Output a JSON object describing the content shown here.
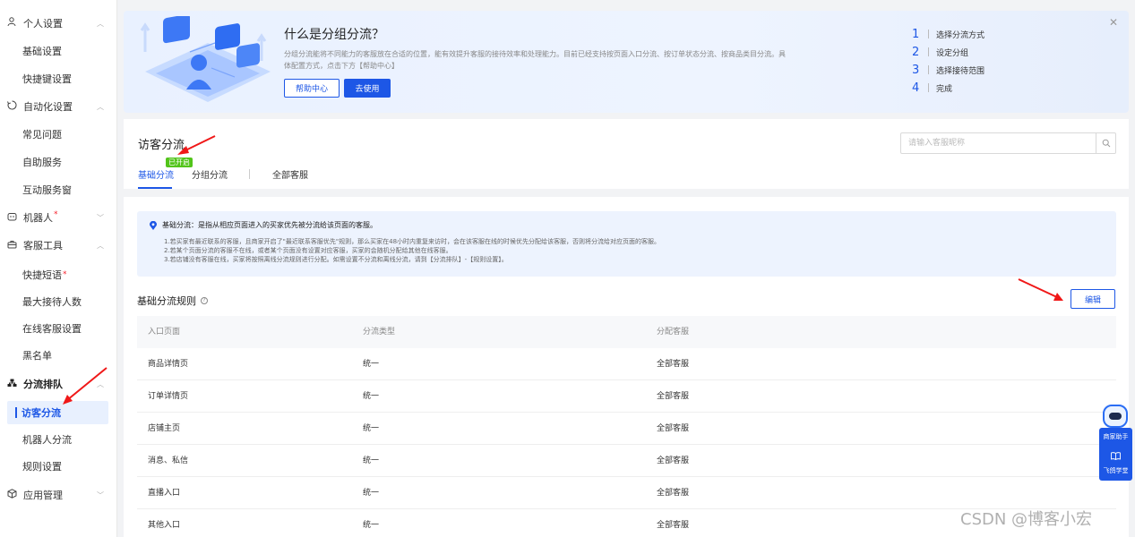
{
  "sidebar": {
    "group_personal": "个人设置",
    "item_basic": "基础设置",
    "item_shortcut": "快捷键设置",
    "group_automation": "自动化设置",
    "item_faq": "常见问题",
    "item_self_service": "自助服务",
    "item_interactive": "互动服务窗",
    "group_robot": "机器人",
    "group_tools": "客服工具",
    "item_quick_phrases": "快捷短语",
    "item_max_reception": "最大接待人数",
    "item_online_settings": "在线客服设置",
    "item_blacklist": "黑名单",
    "group_routing": "分流排队",
    "item_visitor_routing": "访客分流",
    "item_robot_routing": "机器人分流",
    "item_rule_settings": "规则设置",
    "group_app_mgmt": "应用管理",
    "required_marker": "*"
  },
  "banner": {
    "title": "什么是分组分流？",
    "description": "分组分流能将不同能力的客服放在合适的位置，能有效提升客服的接待效率和处理能力。目前已经支持按页面入口分流、按订单状态分流、按商品类目分流。具体配置方式，点击下方【帮助中心】",
    "help_button": "帮助中心",
    "use_button": "去使用",
    "steps": [
      {
        "num": "1",
        "label": "选择分流方式"
      },
      {
        "num": "2",
        "label": "设定分组"
      },
      {
        "num": "3",
        "label": "选择接待范围"
      },
      {
        "num": "4",
        "label": "完成"
      }
    ]
  },
  "header": {
    "title": "访客分流",
    "search_placeholder": "请输入客服昵称",
    "tabs": {
      "basic": "基础分流",
      "group": "分组分流",
      "all": "全部客服",
      "badge": "已开启"
    }
  },
  "info": {
    "headline": "基础分流：是指从相应页面进入的买家优先被分流给该页面的客服。",
    "lines": [
      "1.若买家有最近联系的客服，且商家开启了\"最近联系客服优先\"规则，那么买家在48小时内重复来访时，会在该客服在线的时候优先分配给该客服，否则将分流给对应页面的客服。",
      "2.若某个页面分流的客服不在线，或者某个页面没有设置对应客服，买家的会随机分配给其他在线客服。",
      "3.若店铺没有客服在线，买家将按照离线分流规则进行分配。如需设置不分流和离线分流，请到【分流排队】-【规则设置】。"
    ]
  },
  "rules": {
    "title": "基础分流规则",
    "edit_button": "编辑",
    "columns": [
      "入口页面",
      "分流类型",
      "分配客服"
    ],
    "rows": [
      [
        "商品详情页",
        "统一",
        "全部客服"
      ],
      [
        "订单详情页",
        "统一",
        "全部客服"
      ],
      [
        "店铺主页",
        "统一",
        "全部客服"
      ],
      [
        "消息、私信",
        "统一",
        "全部客服"
      ],
      [
        "直播入口",
        "统一",
        "全部客服"
      ],
      [
        "其他入口",
        "统一",
        "全部客服"
      ]
    ]
  },
  "helper": {
    "assistant_label": "商家助手",
    "academy_label": "飞鸽学堂"
  },
  "watermark": "CSDN @博客小宏",
  "colors": {
    "primary": "#1d57e6",
    "badge_green": "#52c41a",
    "arrow_red": "#f01818",
    "info_bg": "#edf3fe"
  }
}
